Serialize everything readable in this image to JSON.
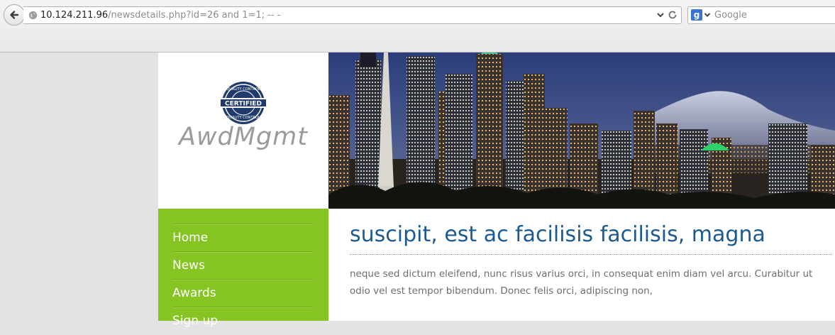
{
  "browser": {
    "url_host": "10.124.211.96",
    "url_path": "/newsdetails.php?id=26 and 1=1; -- -",
    "search_engine_letter": "g",
    "search_placeholder": "Google"
  },
  "site": {
    "badge_top_text": "QUALITY CONTROL",
    "badge_center_text": "CERTIFIED",
    "badge_bottom_text": "QUALITY CONTROL",
    "name": "AwdMgmt"
  },
  "nav": {
    "items": [
      {
        "label": "Home"
      },
      {
        "label": "News"
      },
      {
        "label": "Awards"
      },
      {
        "label": "Sign up"
      }
    ]
  },
  "article": {
    "title": "suscipit, est ac facilisis facilisis, magna",
    "body": "neque sed dictum eleifend, nunc risus varius orci, in consequat enim diam vel arcu. Curabitur ut odio vel est tempor bibendum. Donec felis orci, adipiscing non,"
  },
  "colors": {
    "nav_green": "#86c424",
    "title_blue": "#1c5a93",
    "badge_navy": "#1f3a6b"
  },
  "icons": {
    "back": "back-arrow-icon",
    "site": "globe-icon",
    "dropdown": "chevron-down-icon",
    "reload": "reload-icon",
    "badge": "certified-badge-icon"
  }
}
